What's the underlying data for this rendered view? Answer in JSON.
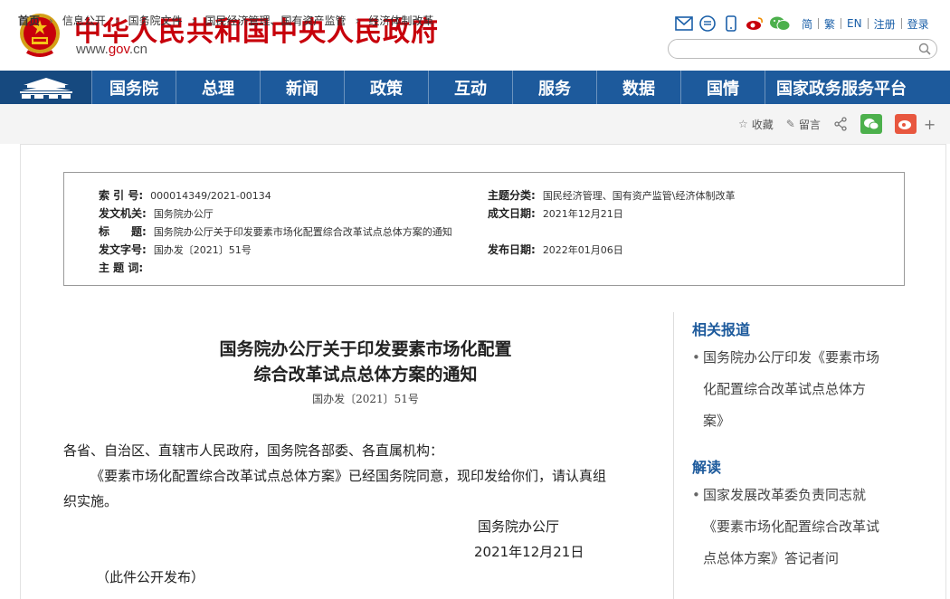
{
  "header": {
    "site_title": "中华人民共和国中央人民政府",
    "site_url_prefix": "www.",
    "site_url_gov": "gov",
    "site_url_suffix": ".cn",
    "links": [
      "简",
      "繁",
      "EN",
      "注册",
      "登录"
    ],
    "search_placeholder": ""
  },
  "nav": {
    "items": [
      "国务院",
      "总理",
      "新闻",
      "政策",
      "互动",
      "服务",
      "数据",
      "国情",
      "国家政务服务平台"
    ]
  },
  "breadcrumb": {
    "items": [
      "首页",
      "信息公开",
      "国务院文件",
      "国民经济管理、国有资产监管",
      "经济体制改革"
    ]
  },
  "share": {
    "collect": "收藏",
    "comment": "留言",
    "plus": "+"
  },
  "meta": {
    "index_label": "索 引 号:",
    "index_value": "000014349/2021-00134",
    "topic_label": "主题分类:",
    "topic_value": "国民经济管理、国有资产监管\\经济体制改革",
    "issuer_label": "发文机关:",
    "issuer_value": "国务院办公厅",
    "made_label": "成文日期:",
    "made_value": "2021年12月21日",
    "title_label": "标　　题:",
    "title_value": "国务院办公厅关于印发要素市场化配置综合改革试点总体方案的通知",
    "docno_label": "发文字号:",
    "docno_value": "国办发〔2021〕51号",
    "pub_label": "发布日期:",
    "pub_value": "2022年01月06日",
    "keyword_label": "主 题 词:",
    "keyword_value": ""
  },
  "article": {
    "title_line1": "国务院办公厅关于印发要素市场化配置",
    "title_line2": "综合改革试点总体方案的通知",
    "doc_no": "国办发〔2021〕51号",
    "salutation": "各省、自治区、直辖市人民政府，国务院各部委、各直属机构：",
    "para1_line1": "《要素市场化配置综合改革试点总体方案》已经国务院同意，现印发给你们，请认真组",
    "para1_line2": "织实施。",
    "signer": "国务院办公厅",
    "sign_date": "2021年12月21日",
    "note": "（此件公开发布）"
  },
  "side": {
    "related_title": "相关报道",
    "related_lines": [
      "国务院办公厅印发《要素市场",
      "化配置综合改革试点总体方",
      "案》"
    ],
    "interpret_title": "解读",
    "interpret_lines": [
      "国家发展改革委负责同志就",
      "《要素市场化配置综合改革试",
      "点总体方案》答记者问"
    ]
  },
  "colors": {
    "brand_red": "#c7000b",
    "nav_blue": "#1d5a9c",
    "wechat_green": "#4cb04c",
    "weibo_red": "#e8573f"
  }
}
